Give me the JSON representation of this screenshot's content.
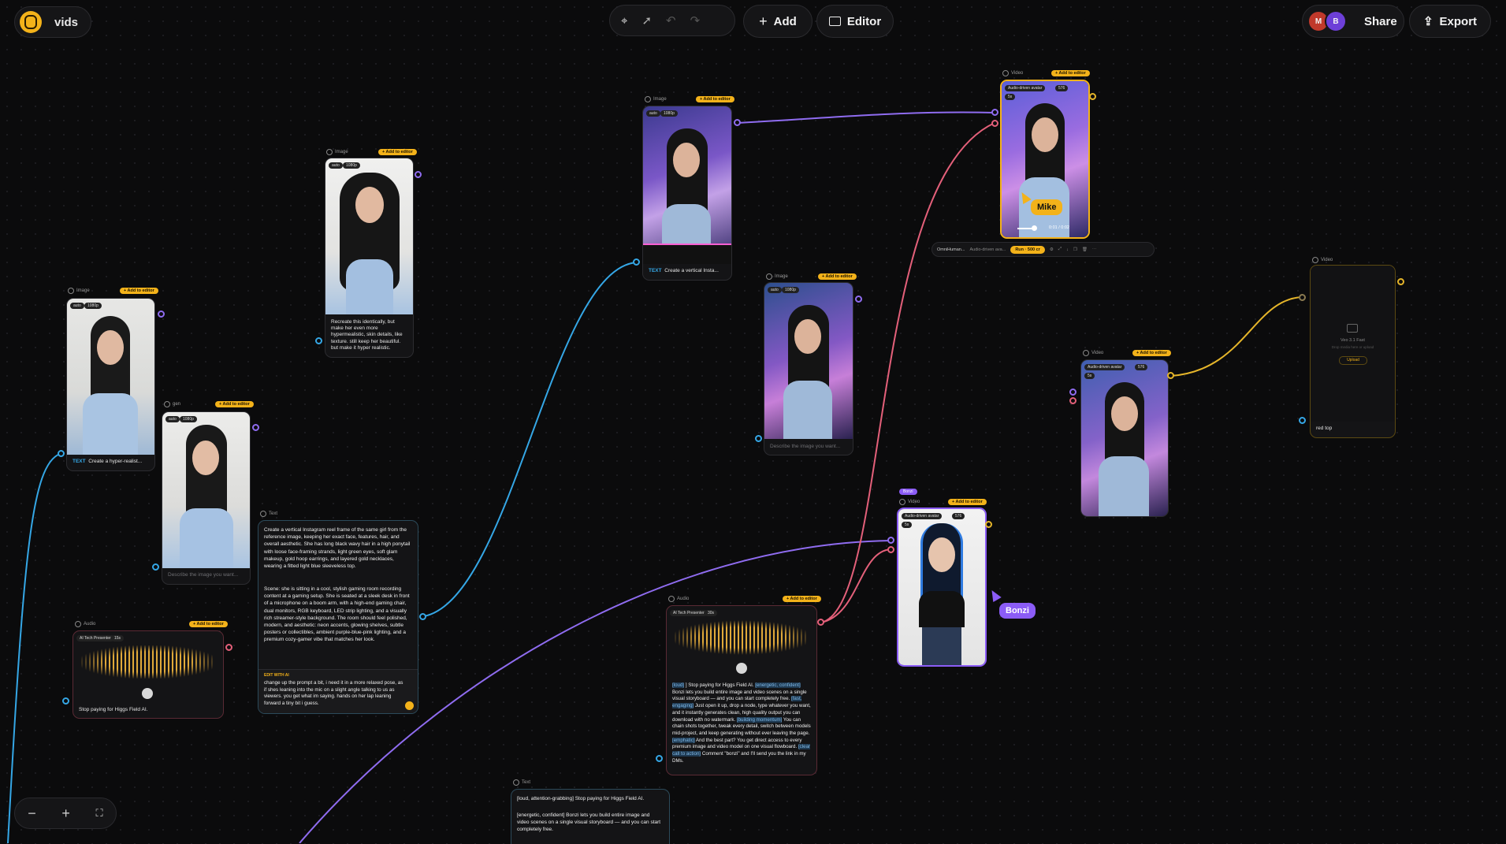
{
  "app": {
    "project_name": "vids",
    "brand_color": "#f3b21a"
  },
  "toolbar": {
    "add_label": "Add",
    "editor_label": "Editor",
    "share_label": "Share",
    "export_label": "Export"
  },
  "collaborators": [
    {
      "initial": "M",
      "color": "#c0392b"
    },
    {
      "initial": "B",
      "color": "#6d3fd8"
    }
  ],
  "common": {
    "add_to_editor": "+ Add to editor",
    "tag_auto": "auto",
    "tag_1080p": "1080p",
    "tag_5s": "5s",
    "describe_placeholder": "Describe the image you want..."
  },
  "nodes": {
    "image1": {
      "type": "Image",
      "text_label": "TEXT",
      "caption": "Create a hyper-realist..."
    },
    "gen": {
      "type": "gen"
    },
    "image2": {
      "type": "Image",
      "caption": "Recreate this identically, but make her even more hypermealistic, skin details, like texture. still keep her beautiful. but make it hyper realistic."
    },
    "text1": {
      "type": "Text",
      "para1": "Create a vertical Instagram reel frame of the same girl from the reference image, keeping her exact face, features, hair, and overall aesthetic. She has long black wavy hair in a high ponytail with loose face-framing strands, light green eyes, soft glam makeup, gold hoop earrings, and layered gold necklaces, wearing a fitted light blue sleeveless top.",
      "para2": "Scene: she is sitting in a cool, stylish gaming room recording content at a gaming setup. She is seated at a sleek desk in front of a microphone on a boom arm, with a high-end gaming chair, dual monitors, RGB keyboard, LED strip lighting, and a visually rich streamer-style background. The room should feel polished, modern, and aesthetic: neon accents, glowing shelves, subtle posters or collectibles, ambient purple-blue-pink lighting, and a premium cozy-gamer vibe that matches her look.",
      "edit_label": "EDIT WITH AI",
      "edit_text": "change up the prompt a bit, i need it in a more relaxed pose, as if shes leaning into the mic on a slight angle talking to us as viewers. you get what im saying. hands on her lap leaning forward a tiny bit i guess."
    },
    "audio1": {
      "type": "Audio",
      "voice": "AI Tech Presenter",
      "duration": "15s",
      "caption": "Stop paying for Higgs Field AI."
    },
    "image3": {
      "type": "Image",
      "text_label": "TEXT",
      "caption": "Create a vertical Insta..."
    },
    "image4": {
      "type": "Image"
    },
    "video1": {
      "type": "Video",
      "model": "Audio-driven avatar",
      "res": "576",
      "time": "0:01 / 0:02"
    },
    "runbar": {
      "model": "OmniHuman...",
      "sub": "Audio-driven ava...",
      "run_label": "Run · 500 cr"
    },
    "video2": {
      "type": "Video",
      "model": "Audio-driven avatar",
      "res": "576"
    },
    "video3": {
      "type": "Video",
      "sub": "Veo 3.1 Fast",
      "hint": "Drop media here or upload",
      "upload": "Upload",
      "caption": "red top"
    },
    "video4": {
      "type": "Video",
      "bonzi_badge": "Bonzi",
      "model": "Audio-driven avatar",
      "res": "576"
    },
    "audio2": {
      "type": "Audio",
      "voice": "AI Tech Presenter",
      "duration": "30s",
      "script_segments": [
        {
          "t": "[loud]",
          "tag": true
        },
        {
          "t": " ] Stop paying for Higgs Field AI. ",
          "tag": false
        },
        {
          "t": "[energetic, confident]",
          "tag": true
        },
        {
          "t": " Bonzi lets you build entire image and video scenes on a single visual storyboard — and you can start completely free. ",
          "tag": false
        },
        {
          "t": "[fast, engaging]",
          "tag": true
        },
        {
          "t": " Just open it up, drop a node, type whatever you want, and it instantly generates clean, high quality output you can download with no watermark. ",
          "tag": false
        },
        {
          "t": "[building momentum]",
          "tag": true
        },
        {
          "t": " You can chain shots together, tweak every detail, switch between models mid-project, and keep generating without ever leaving the page. ",
          "tag": false
        },
        {
          "t": "[emphatic]",
          "tag": true
        },
        {
          "t": " And the best part? You get direct access to every premium image and video model on one visual flowboard. ",
          "tag": false
        },
        {
          "t": "[clear call to action]",
          "tag": true
        },
        {
          "t": " Comment \"bonzi\" and I'll send you the link in my DMs.",
          "tag": false
        }
      ]
    },
    "text2": {
      "type": "Text",
      "line1": "[loud, attention-grabbing] Stop paying for Higgs Field AI.",
      "line2": "[energetic, confident] Bonzi lets you build entire image and video scenes on a single visual storyboard — and you can start completely free."
    }
  },
  "cursors": [
    {
      "name": "Mike",
      "color": "#f3b21a"
    },
    {
      "name": "Bonzi",
      "color": "#8b5cf6"
    }
  ],
  "wire_colors": {
    "blue": "#35a7e6",
    "purple": "#8f6cf0",
    "pink": "#e4607a",
    "yellow": "#e5b52a"
  }
}
